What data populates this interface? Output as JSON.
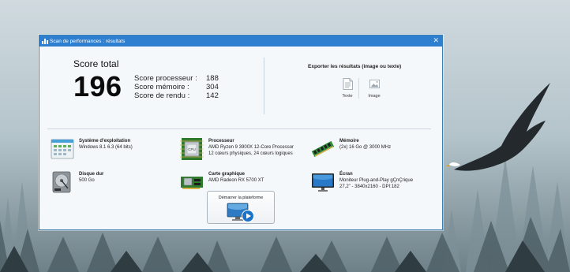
{
  "window": {
    "title": "Scan de performances : résultats",
    "close_glyph": "✕"
  },
  "scores": {
    "title": "Score total",
    "total": "196",
    "rows": [
      {
        "label": "Score processeur :",
        "value": "188"
      },
      {
        "label": "Score mémoire :",
        "value": "304"
      },
      {
        "label": "Score de rendu :",
        "value": "142"
      }
    ]
  },
  "export": {
    "title": "Exporter les résultats (image ou texte)",
    "text_label": "Texte",
    "image_label": "Image"
  },
  "components": {
    "os": {
      "title": "Système d'exploitation",
      "line1": "Windows 8.1 6.3 (64 bits)",
      "icon": "windows-os-icon"
    },
    "cpu": {
      "title": "Processeur",
      "line1": "AMD Ryzen 9 3900X 12-Core Processor",
      "line2": "12 cœurs physiques, 24 cœurs logiques",
      "icon": "cpu-icon"
    },
    "ram": {
      "title": "Mémoire",
      "line1": "(2x) 16 Go @ 3000 MHz",
      "icon": "ram-icon"
    },
    "disk": {
      "title": "Disque dur",
      "line1": "500 Go",
      "icon": "hard-disk-icon"
    },
    "gpu": {
      "title": "Carte graphique",
      "line1": "AMD Radeon RX 5700 XT",
      "icon": "graphics-card-icon"
    },
    "screen": {
      "title": "Écran",
      "line1": "Moniteur Plug-and-Play gÇnÇrique",
      "line2": "27,2\" - 3840x2160 - DPI:182",
      "icon": "monitor-icon"
    }
  },
  "start_button": {
    "label": "Démarrer la plateforme",
    "icon": "monitor-play-icon"
  },
  "colors": {
    "titlebar": "#2f7fd0",
    "accent": "#1a73c8"
  }
}
